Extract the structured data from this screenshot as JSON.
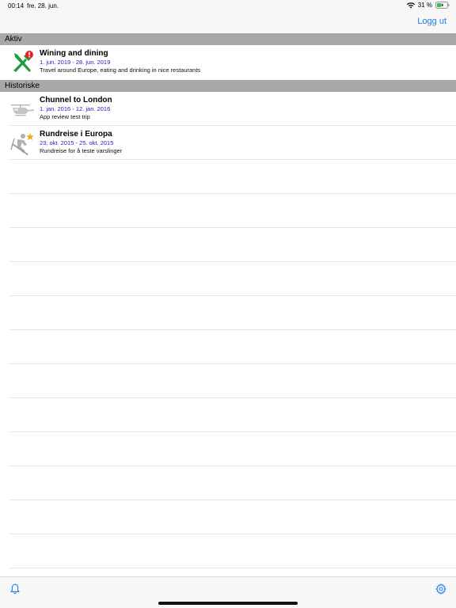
{
  "status_bar": {
    "time": "00:14",
    "date": "fre. 28. jun.",
    "battery": "31 %"
  },
  "nav": {
    "logout_label": "Logg ut"
  },
  "sections": {
    "active_label": "Aktiv",
    "history_label": "Historiske"
  },
  "active_trips": [
    {
      "title": "Wining and dining",
      "dates": "1. jun. 2019 - 28. jun. 2019",
      "description": "Travel around Europe, eating and drinking in nice restaurants",
      "icon": "fork-knife-icon"
    }
  ],
  "history_trips": [
    {
      "title": "Chunnel to London",
      "dates": "1. jan. 2016 - 12. jan. 2016",
      "description": "App review test trip",
      "icon": "helicopter-icon"
    },
    {
      "title": "Rundreise i Europa",
      "dates": "23. okt. 2015 - 25. okt. 2015",
      "description": "Rundreise for å teste varslinger",
      "icon": "ski-icon"
    }
  ],
  "colors": {
    "accent": "#1a7cf3",
    "section_bg": "#a8a8a8",
    "date_text": "#2222bb",
    "active_icon": "#1e9e3a",
    "alert_badge": "#e0252b",
    "star": "#f5a623"
  },
  "toolbar": {
    "left_icon": "bell-icon",
    "right_icon": "gear-icon"
  }
}
